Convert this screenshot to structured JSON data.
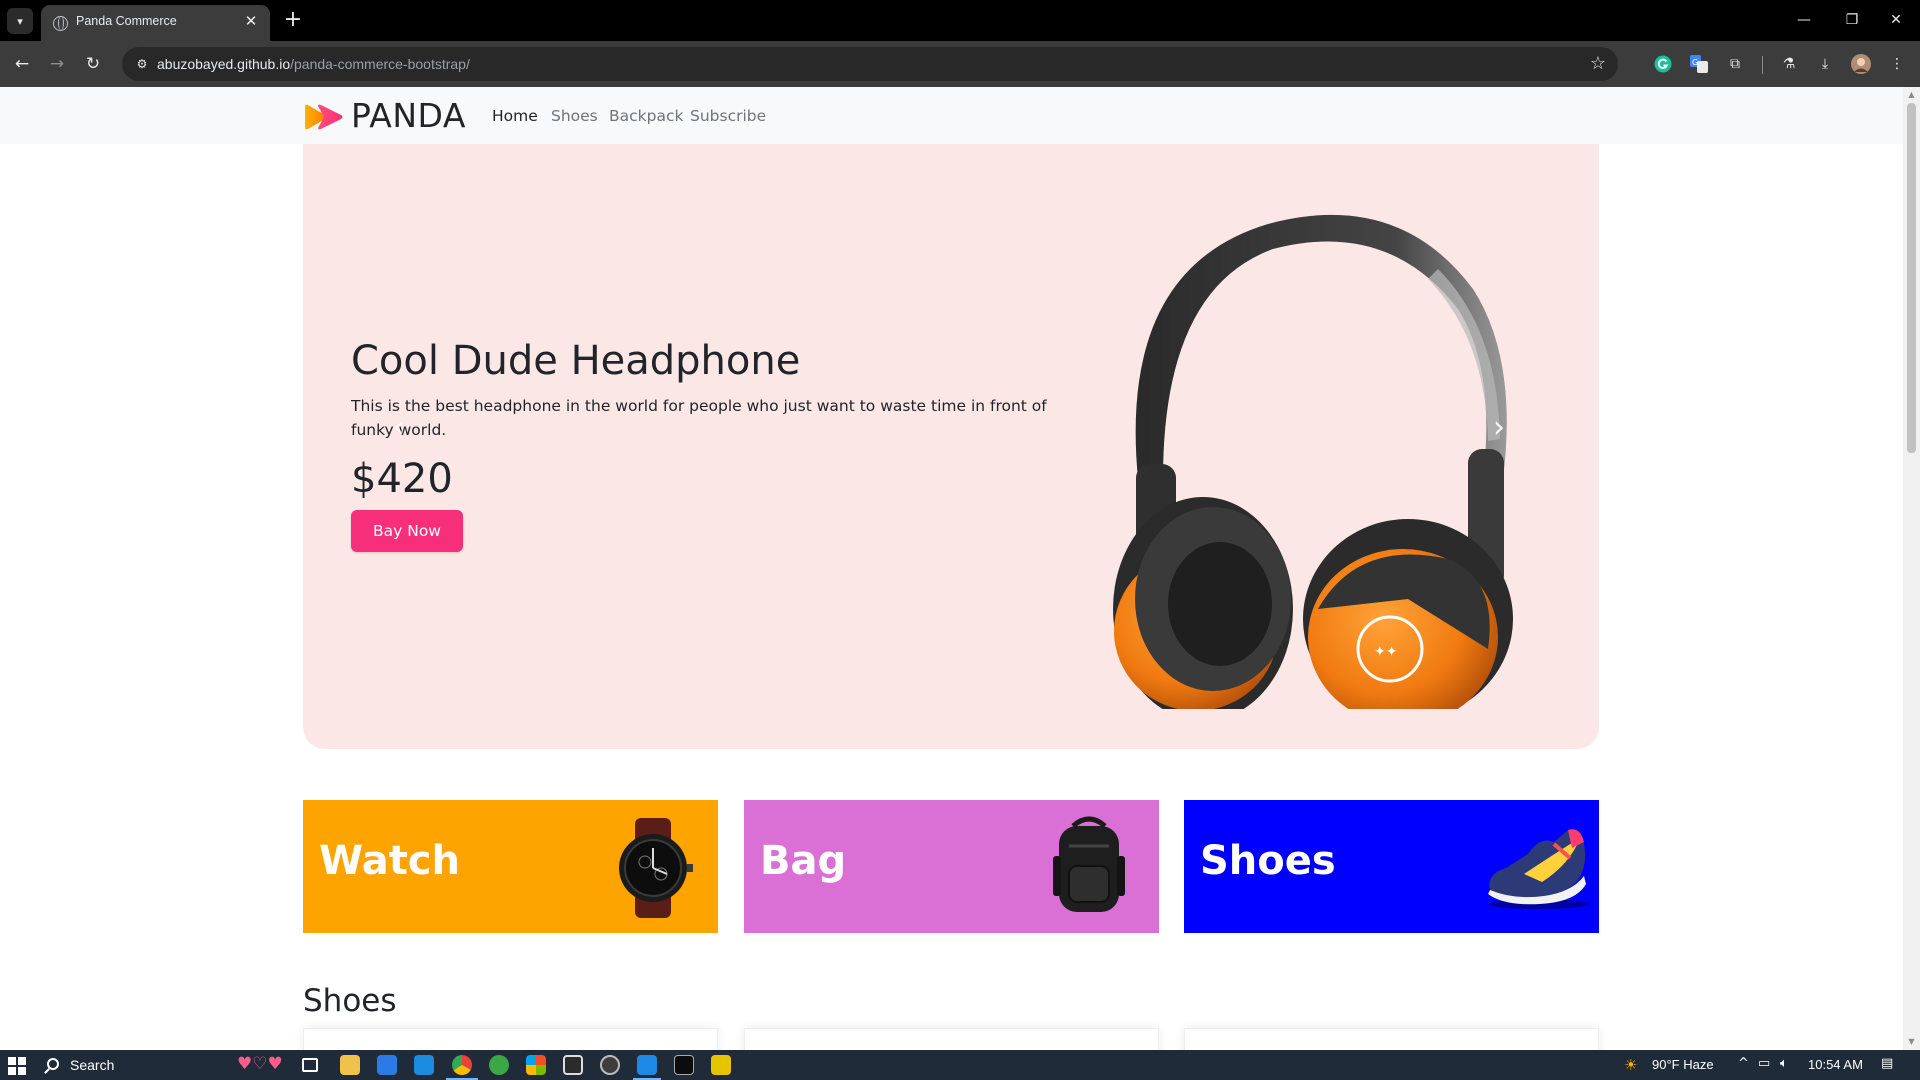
{
  "browser": {
    "tab_title": "Panda Commerce",
    "url_host": "abuzobayed.github.io",
    "url_path": "/panda-commerce-bootstrap/",
    "close_tab_glyph": "✕",
    "new_tab_glyph": "+"
  },
  "site": {
    "brand": "PANDA",
    "nav": [
      {
        "label": "Home",
        "active": true
      },
      {
        "label": "Shoes",
        "active": false
      },
      {
        "label": "Backpack",
        "active": false
      },
      {
        "label": "Subscribe",
        "active": false
      }
    ],
    "hero": {
      "title": "Cool Dude Headphone",
      "description": "This is the best headphone in the world for people who just want to waste time in front of funky world.",
      "price": "$420",
      "cta": "Bay Now"
    },
    "categories": [
      {
        "label": "Watch",
        "color": "#fea400",
        "icon": "watch-image"
      },
      {
        "label": "Bag",
        "color": "#da70d6",
        "icon": "backpack-image"
      },
      {
        "label": "Shoes",
        "color": "#0000fe",
        "icon": "sneaker-image"
      }
    ],
    "section_title": "Shoes"
  },
  "taskbar": {
    "search_label": "Search",
    "weather": "90°F  Haze",
    "time": "10:54 AM"
  },
  "colors": {
    "hero_bg": "#fbe8e6",
    "cta": "#f72e7a",
    "navbar_bg": "#f8f9fa"
  }
}
